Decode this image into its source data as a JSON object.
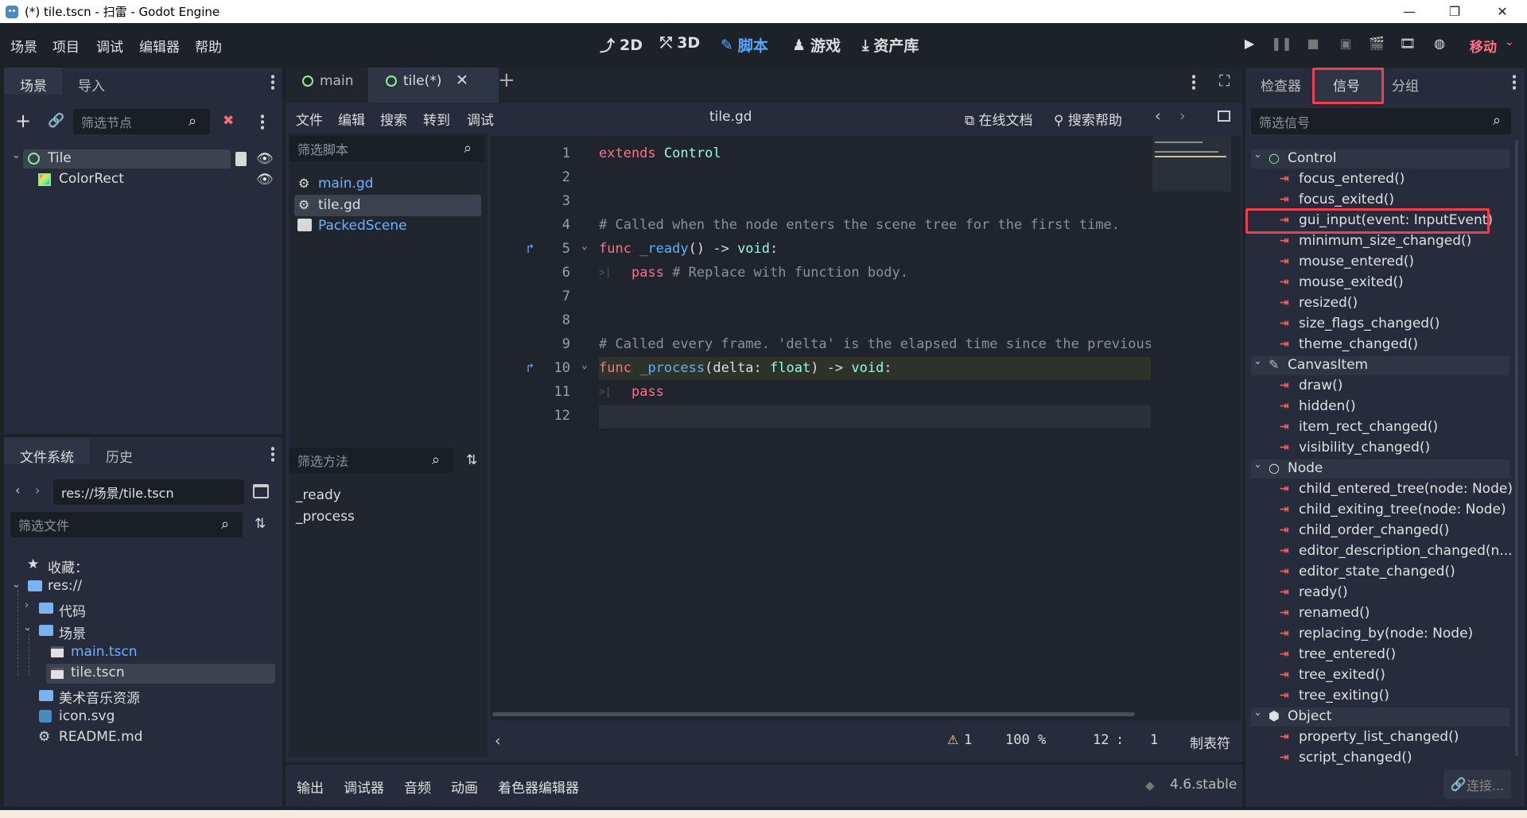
{
  "window": {
    "title": "(*) tile.tscn - 扫雷 - Godot Engine",
    "controls": [
      "—",
      "❐",
      "✕"
    ]
  },
  "menu": [
    "场景",
    "项目",
    "调试",
    "编辑器",
    "帮助"
  ],
  "workspaces": [
    {
      "label": "2D",
      "icon": "2d-icon",
      "active": false
    },
    {
      "label": "3D",
      "icon": "3d-icon",
      "active": false
    },
    {
      "label": "脚本",
      "icon": "script-icon",
      "active": true
    },
    {
      "label": "游戏",
      "icon": "game-icon",
      "active": false
    },
    {
      "label": "资产库",
      "icon": "assetlib-icon",
      "active": false
    }
  ],
  "renderer": "移动",
  "scene_dock": {
    "tabs": [
      "场景",
      "导入"
    ],
    "filter_placeholder": "筛选节点",
    "nodes": [
      {
        "label": "Tile",
        "icon": "control-icon"
      },
      {
        "label": "ColorRect",
        "icon": "colorrect-icon"
      }
    ]
  },
  "filesystem_dock": {
    "tabs": [
      "文件系统",
      "历史"
    ],
    "path": "res://场景/tile.tscn",
    "filter_placeholder": "筛选文件",
    "items": [
      {
        "label": "收藏：",
        "icon": "star-icon"
      },
      {
        "label": "res://",
        "icon": "folder-icon"
      },
      {
        "label": "代码",
        "icon": "folder-icon"
      },
      {
        "label": "场景",
        "icon": "folder-icon"
      },
      {
        "label": "main.tscn",
        "icon": "scene-file-icon"
      },
      {
        "label": "tile.tscn",
        "icon": "scene-file-icon"
      },
      {
        "label": "美术音乐资源",
        "icon": "folder-icon"
      },
      {
        "label": "icon.svg",
        "icon": "image-file-icon"
      },
      {
        "label": "README.md",
        "icon": "text-file-icon"
      }
    ]
  },
  "editor_tabs": [
    "main",
    "tile(*)"
  ],
  "script_menu": [
    "文件",
    "编辑",
    "搜索",
    "转到",
    "调试"
  ],
  "script_title": "tile.gd",
  "online_docs": "在线文档",
  "search_help": "搜索帮助",
  "script_filter_placeholder": "筛选脚本",
  "scripts": [
    "main.gd",
    "tile.gd",
    "PackedScene"
  ],
  "method_filter_placeholder": "筛选方法",
  "methods": [
    "_ready",
    "_process"
  ],
  "code_lines": [
    "1",
    "2",
    "3",
    "4",
    "5",
    "6",
    "7",
    "8",
    "9",
    "10",
    "11",
    "12"
  ],
  "code": {
    "l1a": "extends",
    "l1b": "Control",
    "l4": "# Called when the node enters the scene tree for the first time.",
    "l5a": "func",
    "l5b": "_ready",
    "l5c": "() ->",
    "l5d": "void",
    "l5e": ":",
    "l6a": "pass",
    "l6b": "# Replace with function body.",
    "l9": "# Called every frame. 'delta' is the elapsed time since the previous",
    "l10a": "func",
    "l10b": "_process",
    "l10c": "(delta:",
    "l10d": "float",
    "l10e": ") ->",
    "l10f": "void",
    "l10g": ":",
    "l11": "pass"
  },
  "status": {
    "warnings": "1",
    "zoom": "100 %",
    "line": "12",
    "sep": ":",
    "col": "1",
    "indent": "制表符"
  },
  "bottom_tabs": [
    "输出",
    "调试器",
    "音频",
    "动画",
    "着色器编辑器"
  ],
  "version": "4.6.stable",
  "inspector_tabs": [
    "检查器",
    "信号",
    "分组"
  ],
  "signal_filter_placeholder": "筛选信号",
  "signal_groups": [
    {
      "label": "Control",
      "icon": "control-icon",
      "signals": [
        "focus_entered()",
        "focus_exited()",
        "gui_input(event: InputEvent)",
        "minimum_size_changed()",
        "mouse_entered()",
        "mouse_exited()",
        "resized()",
        "size_flags_changed()",
        "theme_changed()"
      ]
    },
    {
      "label": "CanvasItem",
      "icon": "canvasitem-icon",
      "signals": [
        "draw()",
        "hidden()",
        "item_rect_changed()",
        "visibility_changed()"
      ]
    },
    {
      "label": "Node",
      "icon": "node-icon",
      "signals": [
        "child_entered_tree(node: Node)",
        "child_exiting_tree(node: Node)",
        "child_order_changed()",
        "editor_description_changed(n...",
        "editor_state_changed()",
        "ready()",
        "renamed()",
        "replacing_by(node: Node)",
        "tree_entered()",
        "tree_exited()",
        "tree_exiting()"
      ]
    },
    {
      "label": "Object",
      "icon": "object-icon",
      "signals": [
        "property_list_changed()",
        "script_changed()"
      ]
    }
  ],
  "connect_button": "连接...",
  "colors": {
    "accent": "#56a8ff",
    "highlight": "#ef3f4c",
    "keyword": "#ff7085",
    "type": "#8effda"
  }
}
